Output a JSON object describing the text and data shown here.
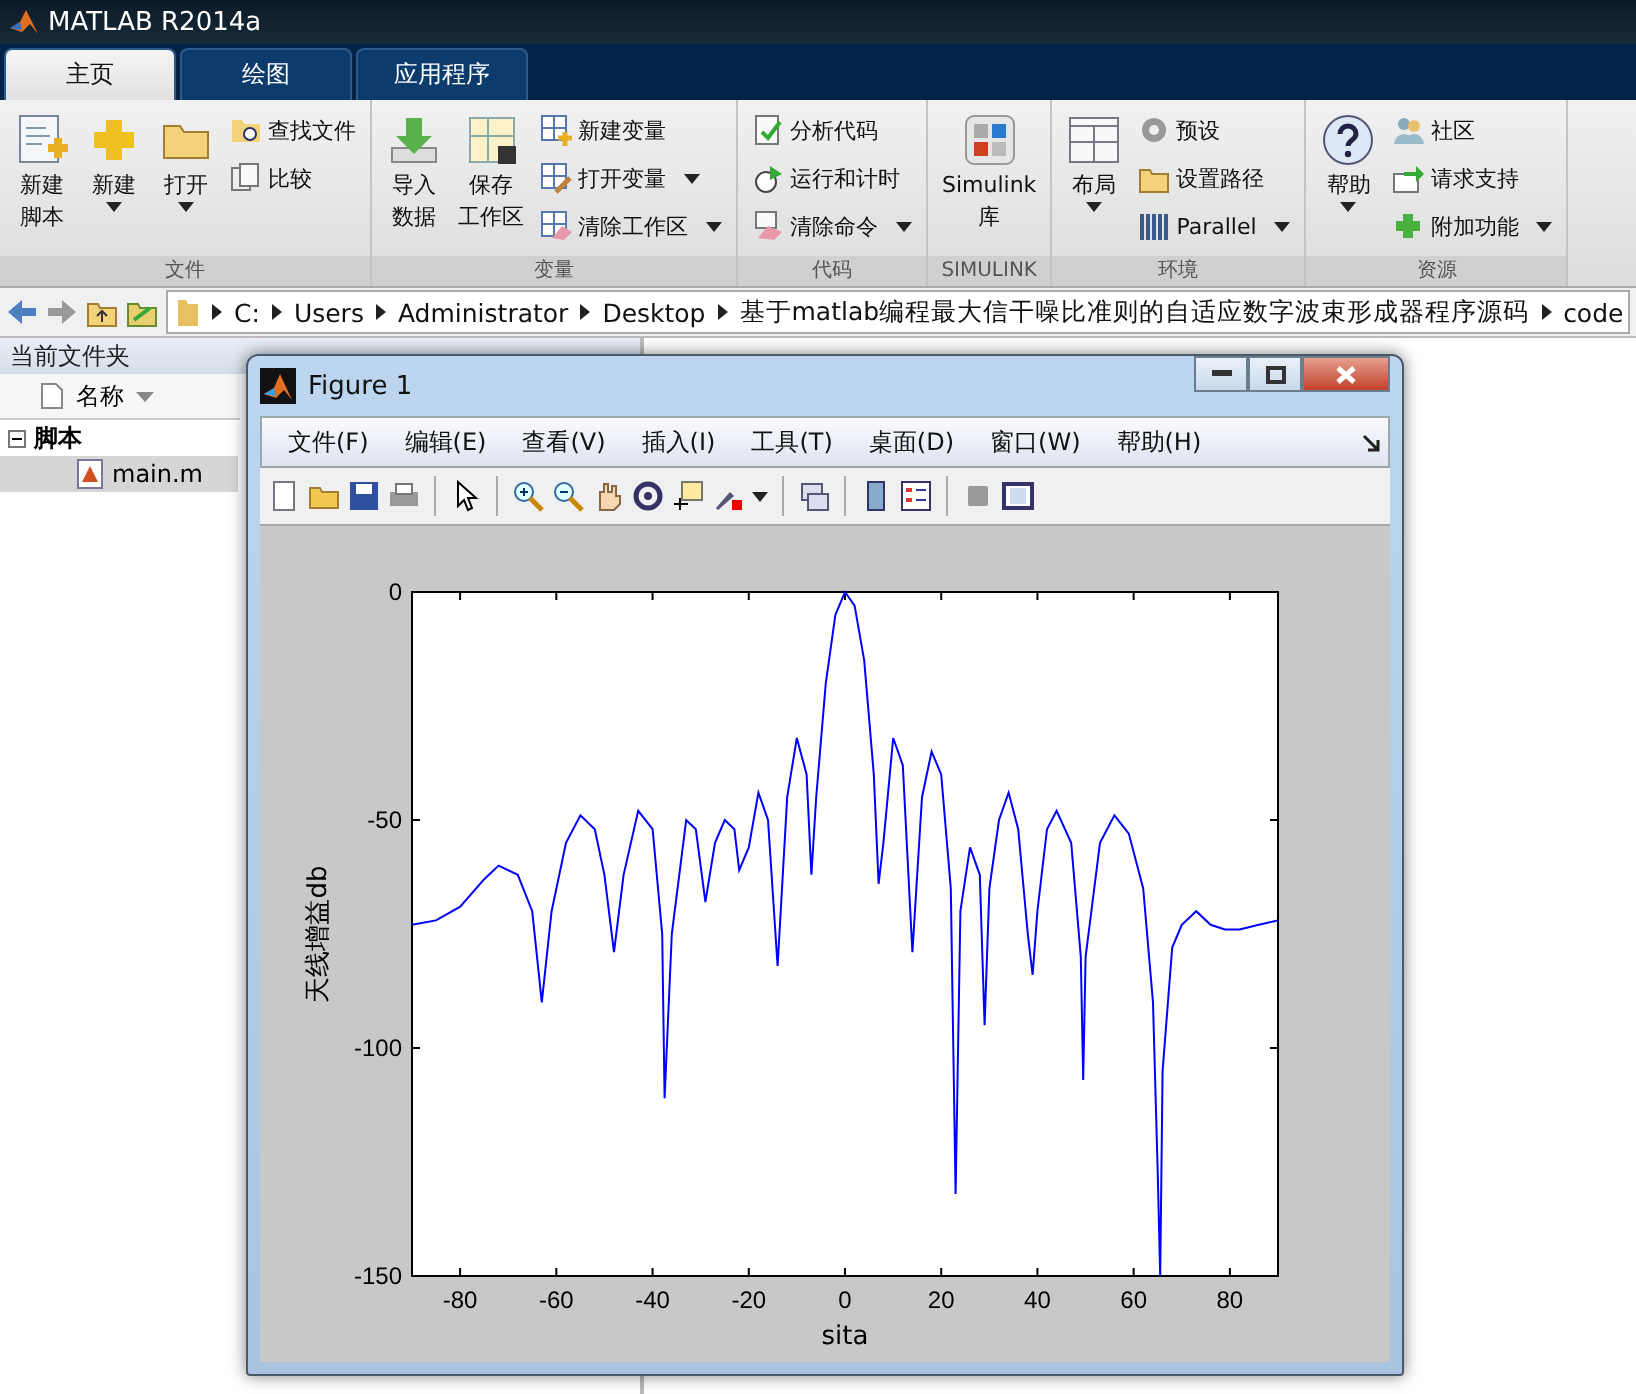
{
  "window": {
    "title": "MATLAB R2014a"
  },
  "tabs": [
    {
      "label": "主页",
      "selected": true
    },
    {
      "label": "绘图",
      "selected": false
    },
    {
      "label": "应用程序",
      "selected": false
    }
  ],
  "ribbon": {
    "groups": [
      {
        "label": "文件",
        "items": [
          {
            "kind": "large",
            "lines": [
              "新建",
              "脚本"
            ],
            "dropdown": false
          },
          {
            "kind": "large",
            "lines": [
              "新建"
            ],
            "dropdown": true
          },
          {
            "kind": "large",
            "lines": [
              "打开"
            ],
            "dropdown": true
          },
          {
            "kind": "stack",
            "items": [
              {
                "label": "查找文件",
                "dropdown": false
              },
              {
                "label": "比较",
                "dropdown": false
              }
            ]
          }
        ]
      },
      {
        "label": "变量",
        "items": [
          {
            "kind": "large",
            "lines": [
              "导入",
              "数据"
            ],
            "dropdown": false
          },
          {
            "kind": "large",
            "lines": [
              "保存",
              "工作区"
            ],
            "dropdown": false
          },
          {
            "kind": "stack",
            "items": [
              {
                "label": "新建变量",
                "dropdown": false
              },
              {
                "label": "打开变量",
                "dropdown": true
              },
              {
                "label": "清除工作区",
                "dropdown": true
              }
            ]
          }
        ]
      },
      {
        "label": "代码",
        "items": [
          {
            "kind": "stack",
            "items": [
              {
                "label": "分析代码",
                "dropdown": false
              },
              {
                "label": "运行和计时",
                "dropdown": false
              },
              {
                "label": "清除命令",
                "dropdown": true
              }
            ]
          }
        ]
      },
      {
        "label": "SIMULINK",
        "items": [
          {
            "kind": "large",
            "lines": [
              "Simulink",
              "库"
            ],
            "dropdown": false
          }
        ]
      },
      {
        "label": "环境",
        "items": [
          {
            "kind": "large",
            "lines": [
              "布局"
            ],
            "dropdown": true
          },
          {
            "kind": "stack",
            "items": [
              {
                "label": "预设",
                "dropdown": false
              },
              {
                "label": "设置路径",
                "dropdown": false
              },
              {
                "label": "Parallel",
                "dropdown": true
              }
            ]
          }
        ]
      },
      {
        "label": "资源",
        "items": [
          {
            "kind": "large",
            "lines": [
              "帮助"
            ],
            "dropdown": true
          },
          {
            "kind": "stack",
            "items": [
              {
                "label": "社区",
                "dropdown": false
              },
              {
                "label": "请求支持",
                "dropdown": false
              },
              {
                "label": "附加功能",
                "dropdown": true
              }
            ]
          }
        ]
      }
    ]
  },
  "address_bar": {
    "path": [
      "C:",
      "Users",
      "Administrator",
      "Desktop",
      "基于matlab编程最大信干噪比准则的自适应数字波束形成器程序源码",
      "code"
    ]
  },
  "current_folder": {
    "title": "当前文件夹",
    "column": "名称",
    "tree": [
      {
        "label": "脚本",
        "expanded": true,
        "selected": false,
        "children": [
          {
            "label": "main.m",
            "selected": true
          }
        ]
      }
    ]
  },
  "figure": {
    "title": "Figure 1",
    "menu": [
      "文件(F)",
      "编辑(E)",
      "查看(V)",
      "插入(I)",
      "工具(T)",
      "桌面(D)",
      "窗口(W)",
      "帮助(H)"
    ],
    "chart_data": {
      "type": "line",
      "xlabel": "sita",
      "ylabel": "天线增益db",
      "x": [
        -90,
        -85,
        -80,
        -75,
        -72,
        -68,
        -65,
        -63,
        -61,
        -58,
        -55,
        -52,
        -50,
        -48,
        -46,
        -43,
        -40,
        -38,
        -37.5,
        -36,
        -33,
        -31,
        -29,
        -27,
        -25,
        -23,
        -22,
        -20,
        -18,
        -16,
        -14,
        -12,
        -10,
        -8,
        -7,
        -6,
        -4,
        -2,
        0,
        2,
        4,
        6,
        7,
        8,
        10,
        12,
        14,
        16,
        18,
        20,
        22,
        23,
        24,
        26,
        28,
        29,
        30,
        32,
        34,
        36,
        38,
        39,
        40,
        42,
        44,
        47,
        49,
        49.5,
        50,
        53,
        56,
        59,
        62,
        64,
        65,
        65.5,
        66,
        68,
        70,
        73,
        76,
        79,
        82,
        86,
        90
      ],
      "series": [
        {
          "color": "#0000ff",
          "values": [
            -73,
            -72,
            -69,
            -63,
            -60,
            -62,
            -70,
            -90,
            -70,
            -55,
            -49,
            -52,
            -62,
            -79,
            -62,
            -48,
            -52,
            -75,
            -111,
            -75,
            -50,
            -52,
            -68,
            -55,
            -50,
            -52,
            -61,
            -56,
            -44,
            -50,
            -82,
            -45,
            -32,
            -40,
            -62,
            -45,
            -20,
            -5,
            0,
            -3,
            -15,
            -40,
            -64,
            -55,
            -32,
            -38,
            -79,
            -45,
            -35,
            -40,
            -65,
            -132,
            -70,
            -56,
            -62,
            -95,
            -65,
            -50,
            -44,
            -52,
            -75,
            -84,
            -70,
            -52,
            -48,
            -55,
            -80,
            -107,
            -80,
            -55,
            -49,
            -53,
            -65,
            -90,
            -128,
            -150,
            -105,
            -78,
            -73,
            -70,
            -73,
            -74,
            -74,
            -73,
            -72
          ]
        }
      ],
      "xlim": [
        -90,
        90
      ],
      "ylim": [
        -150,
        0
      ],
      "xticks": [
        -80,
        -60,
        -40,
        -20,
        0,
        20,
        40,
        60,
        80
      ],
      "yticks": [
        -150,
        -100,
        -50,
        0
      ]
    }
  }
}
